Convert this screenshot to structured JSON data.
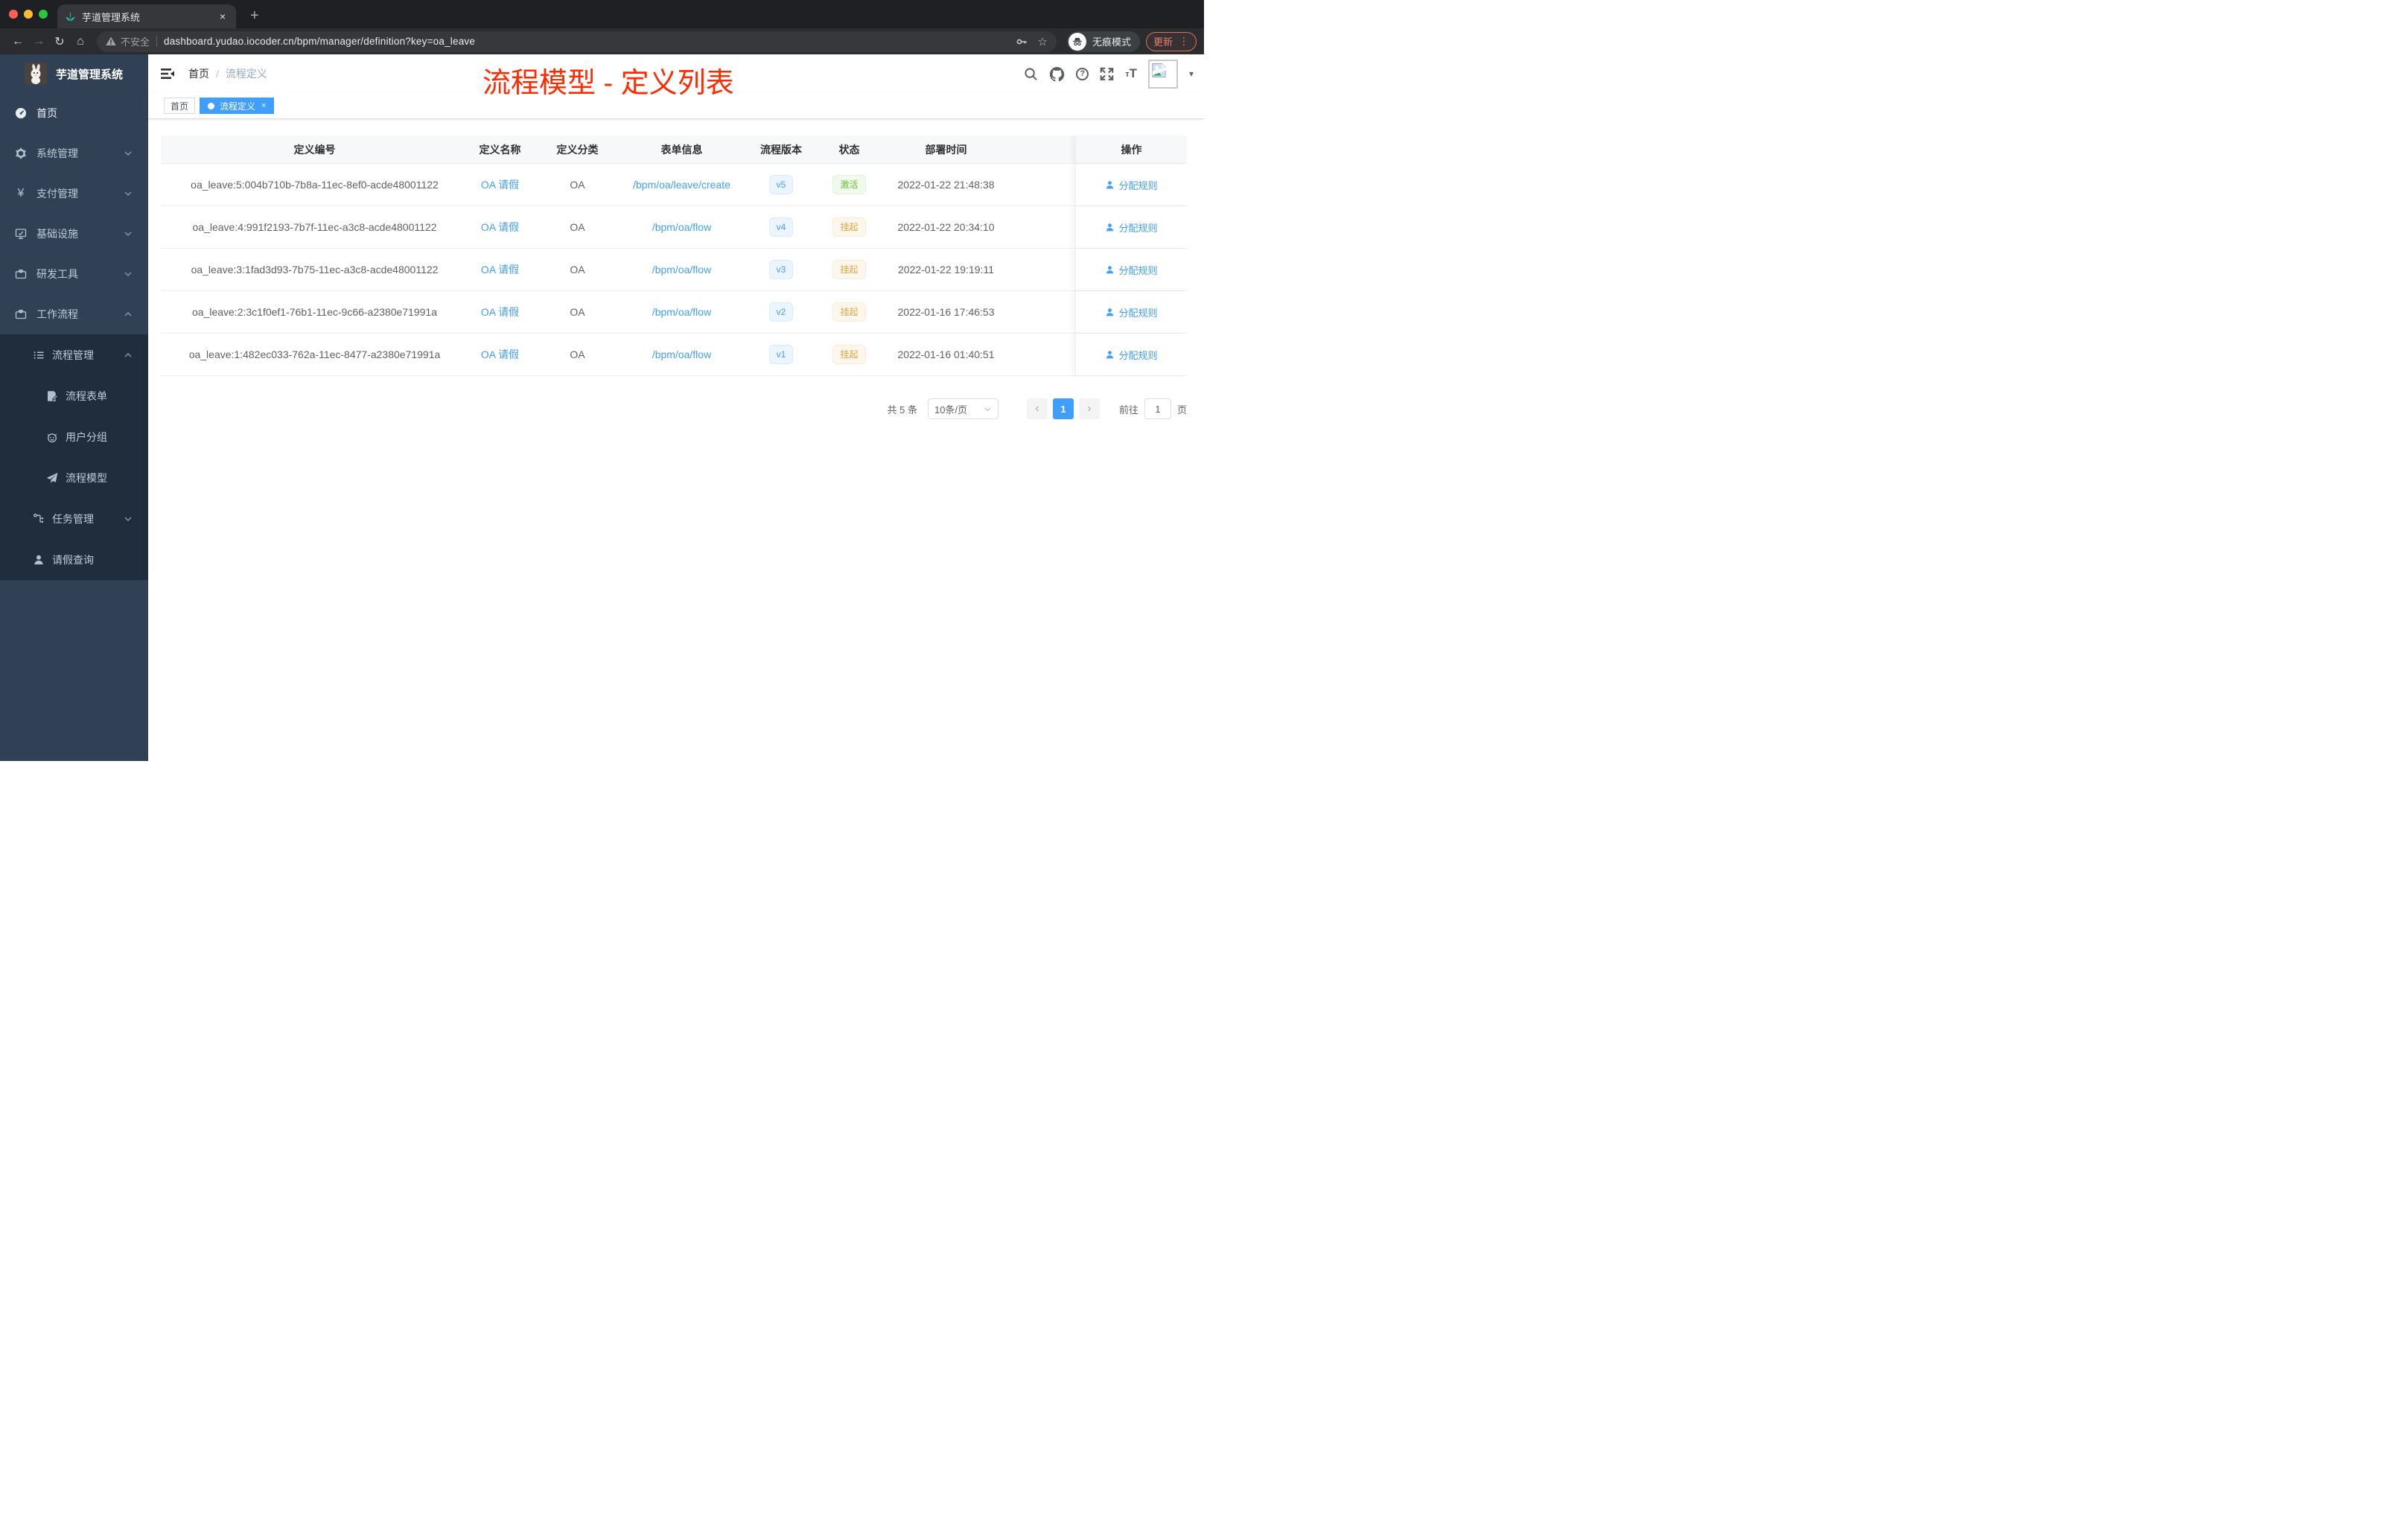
{
  "browser": {
    "tab_title": "芋道管理系统",
    "not_secure": "不安全",
    "url": "dashboard.yudao.iocoder.cn/bpm/manager/definition?key=oa_leave",
    "incognito_label": "无痕模式",
    "update_label": "更新"
  },
  "sidebar": {
    "title": "芋道管理系统",
    "items": [
      {
        "label": "首页"
      },
      {
        "label": "系统管理"
      },
      {
        "label": "支付管理"
      },
      {
        "label": "基础设施"
      },
      {
        "label": "研发工具"
      },
      {
        "label": "工作流程"
      },
      {
        "label": "流程管理"
      },
      {
        "label": "流程表单"
      },
      {
        "label": "用户分组"
      },
      {
        "label": "流程模型"
      },
      {
        "label": "任务管理"
      },
      {
        "label": "请假查询"
      }
    ]
  },
  "header": {
    "breadcrumb": {
      "home": "首页",
      "separator": "/",
      "current": "流程定义"
    },
    "annotation": "流程模型 - 定义列表"
  },
  "tags": {
    "home": "首页",
    "active": "流程定义"
  },
  "table": {
    "columns": [
      "定义编号",
      "定义名称",
      "定义分类",
      "表单信息",
      "流程版本",
      "状态",
      "部署时间",
      "操作"
    ],
    "action_label": "分配规则",
    "rows": [
      {
        "id": "oa_leave:5:004b710b-7b8a-11ec-8ef0-acde48001122",
        "name": "OA 请假",
        "category": "OA",
        "form": "/bpm/oa/leave/create",
        "version": "v5",
        "status": "激活",
        "time": "2022-01-22 21:48:38"
      },
      {
        "id": "oa_leave:4:991f2193-7b7f-11ec-a3c8-acde48001122",
        "name": "OA 请假",
        "category": "OA",
        "form": "/bpm/oa/flow",
        "version": "v4",
        "status": "挂起",
        "time": "2022-01-22 20:34:10"
      },
      {
        "id": "oa_leave:3:1fad3d93-7b75-11ec-a3c8-acde48001122",
        "name": "OA 请假",
        "category": "OA",
        "form": "/bpm/oa/flow",
        "version": "v3",
        "status": "挂起",
        "time": "2022-01-22 19:19:11"
      },
      {
        "id": "oa_leave:2:3c1f0ef1-76b1-11ec-9c66-a2380e71991a",
        "name": "OA 请假",
        "category": "OA",
        "form": "/bpm/oa/flow",
        "version": "v2",
        "status": "挂起",
        "time": "2022-01-16 17:46:53"
      },
      {
        "id": "oa_leave:1:482ec033-762a-11ec-8477-a2380e71991a",
        "name": "OA 请假",
        "category": "OA",
        "form": "/bpm/oa/flow",
        "version": "v1",
        "status": "挂起",
        "time": "2022-01-16 01:40:51"
      }
    ]
  },
  "pagination": {
    "total": "共 5 条",
    "page_size": "10条/页",
    "page": "1",
    "goto_label": "前往",
    "goto_value": "1",
    "unit": "页"
  },
  "icons": {
    "close": "×",
    "plus": "+",
    "back": "←",
    "forward": "→",
    "reload": "↻",
    "home": "⌂",
    "star": "☆",
    "more": "⋮",
    "caret": "▾",
    "help": "?",
    "t_small": "т",
    "t_big": "T",
    "yen": "¥",
    "prev": "‹",
    "next": "›"
  },
  "colors": {
    "accent": "#409EFF",
    "success": "#67C23A",
    "warning": "#E6A23C",
    "annotation": "#FF2B00",
    "sidebar_bg": "#304156",
    "submenu_bg": "#1F2D3D"
  }
}
